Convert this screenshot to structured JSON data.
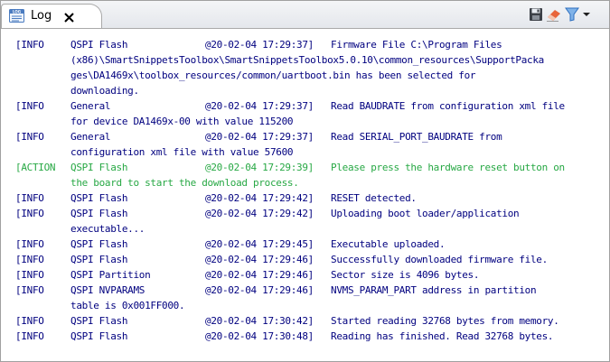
{
  "tab": {
    "label": "Log",
    "icon": "log-icon"
  },
  "toolbar": {
    "save_icon": "save-icon",
    "clear_icon": "eraser-icon",
    "filter_icon": "filter-icon",
    "menu_icon": "view-menu-icon"
  },
  "colors": {
    "info": "#00007f",
    "action": "#27a844"
  },
  "log": [
    {
      "level": "[INFO",
      "source": "QSPI Flash",
      "time": "@20-02-04 17:29:37]",
      "message": "Firmware File C:\\Program Files",
      "continuation": [
        "(x86)\\SmartSnippetsToolbox\\SmartSnippetsToolbox5.0.10\\common_resources\\SupportPacka",
        "ges\\DA1469x\\toolbox_resources/common/uartboot.bin has been selected for",
        "downloading."
      ]
    },
    {
      "level": "[INFO",
      "source": "General",
      "time": "@20-02-04 17:29:37]",
      "message": "Read BAUDRATE from configuration xml file",
      "continuation": [
        "for device DA1469x-00 with value 115200"
      ]
    },
    {
      "level": "[INFO",
      "source": "General",
      "time": "@20-02-04 17:29:37]",
      "message": "Read SERIAL_PORT_BAUDRATE from",
      "continuation": [
        "configuration xml file with value 57600"
      ]
    },
    {
      "level": "[ACTION",
      "source": "QSPI Flash",
      "time": "@20-02-04 17:29:39]",
      "message": "Please press the hardware reset button on",
      "continuation": [
        "the board to start the download process."
      ],
      "action": true
    },
    {
      "level": "[INFO",
      "source": "QSPI Flash",
      "time": "@20-02-04 17:29:42]",
      "message": "RESET detected.",
      "continuation": []
    },
    {
      "level": "[INFO",
      "source": "QSPI Flash",
      "time": "@20-02-04 17:29:42]",
      "message": "Uploading boot loader/application",
      "continuation": [
        "executable..."
      ]
    },
    {
      "level": "[INFO",
      "source": "QSPI Flash",
      "time": "@20-02-04 17:29:45]",
      "message": "Executable uploaded.",
      "continuation": []
    },
    {
      "level": "[INFO",
      "source": "QSPI Flash",
      "time": "@20-02-04 17:29:46]",
      "message": "Successfully downloaded firmware file.",
      "continuation": []
    },
    {
      "level": "[INFO",
      "source": "QSPI Partition",
      "time": "@20-02-04 17:29:46]",
      "message": "Sector size is 4096 bytes.",
      "continuation": []
    },
    {
      "level": "[INFO",
      "source": "QSPI NVPARAMS",
      "time": "@20-02-04 17:29:46]",
      "message": "NVMS_PARAM_PART address in partition",
      "continuation": [
        "table is 0x001FF000."
      ]
    },
    {
      "level": "[INFO",
      "source": "QSPI Flash",
      "time": "@20-02-04 17:30:42]",
      "message": "Started reading 32768 bytes from memory.",
      "continuation": []
    },
    {
      "level": "[INFO",
      "source": "QSPI Flash",
      "time": "@20-02-04 17:30:48]",
      "message": "Reading has finished. Read 32768 bytes.",
      "continuation": []
    }
  ]
}
